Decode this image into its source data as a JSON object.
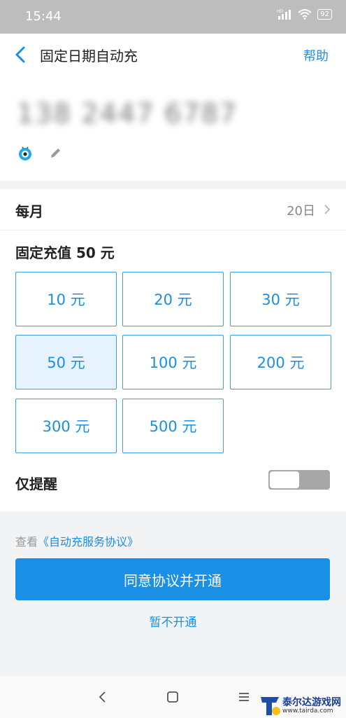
{
  "status_bar": {
    "time": "15:44",
    "signal_label": "HD",
    "battery": "92"
  },
  "header": {
    "back_icon": "chevron-left-icon",
    "title": "固定日期自动充",
    "help_label": "帮助"
  },
  "account": {
    "phone": "138 2447 6787",
    "avatar_icon": "mascot-eye-icon",
    "edit_icon": "pencil-icon"
  },
  "schedule": {
    "label": "每月",
    "value": "20日",
    "chevron_icon": "chevron-right-icon"
  },
  "amount": {
    "title": "固定充值 50 元",
    "selected_index": 3,
    "options": [
      "10 元",
      "20 元",
      "30 元",
      "50 元",
      "100 元",
      "200 元",
      "300 元",
      "500 元"
    ]
  },
  "remind": {
    "label": "仅提醒",
    "enabled": false
  },
  "agreement": {
    "prefix": "查看",
    "link": "《自动充服务协议》"
  },
  "actions": {
    "primary": "同意协议并开通",
    "secondary": "暂不开通"
  },
  "nav_bar": {
    "back": "nav-back-icon",
    "home": "nav-home-icon",
    "menu": "nav-menu-icon"
  },
  "watermark": {
    "name": "泰尔达游戏网",
    "url": "www.tairda.com"
  },
  "colors": {
    "accent": "#1a8fe6",
    "selected_bg": "#e7f3fc",
    "toggle_off": "#a7a7a7"
  }
}
